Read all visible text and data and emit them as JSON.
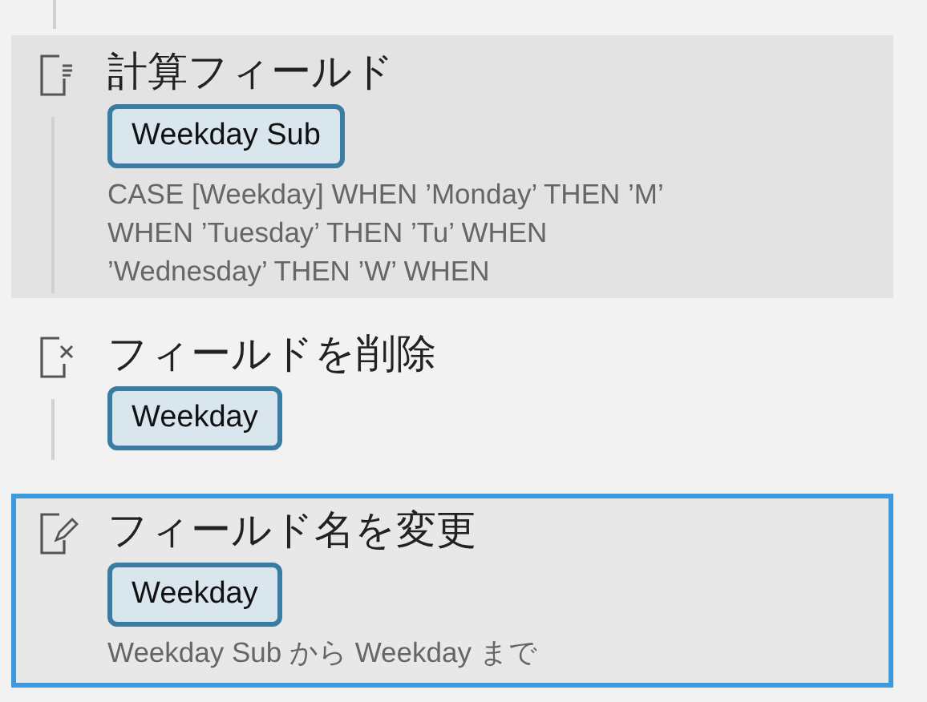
{
  "steps": [
    {
      "kind": "calculated",
      "title": "計算フィールド",
      "fields": [
        "Weekday Sub"
      ],
      "description": "CASE [Weekday] WHEN ’Monday’ THEN ’M’ WHEN ’Tuesday’ THEN ’Tu’ WHEN ’Wednesday’ THEN ’W’ WHEN",
      "highlighted": true,
      "selected": false
    },
    {
      "kind": "remove",
      "title": "フィールドを削除",
      "fields": [
        "Weekday"
      ],
      "highlighted": false,
      "selected": false
    },
    {
      "kind": "rename",
      "title": "フィールド名を変更",
      "fields": [
        "Weekday"
      ],
      "description": "Weekday Sub から Weekday まで",
      "highlighted": false,
      "selected": true
    }
  ]
}
